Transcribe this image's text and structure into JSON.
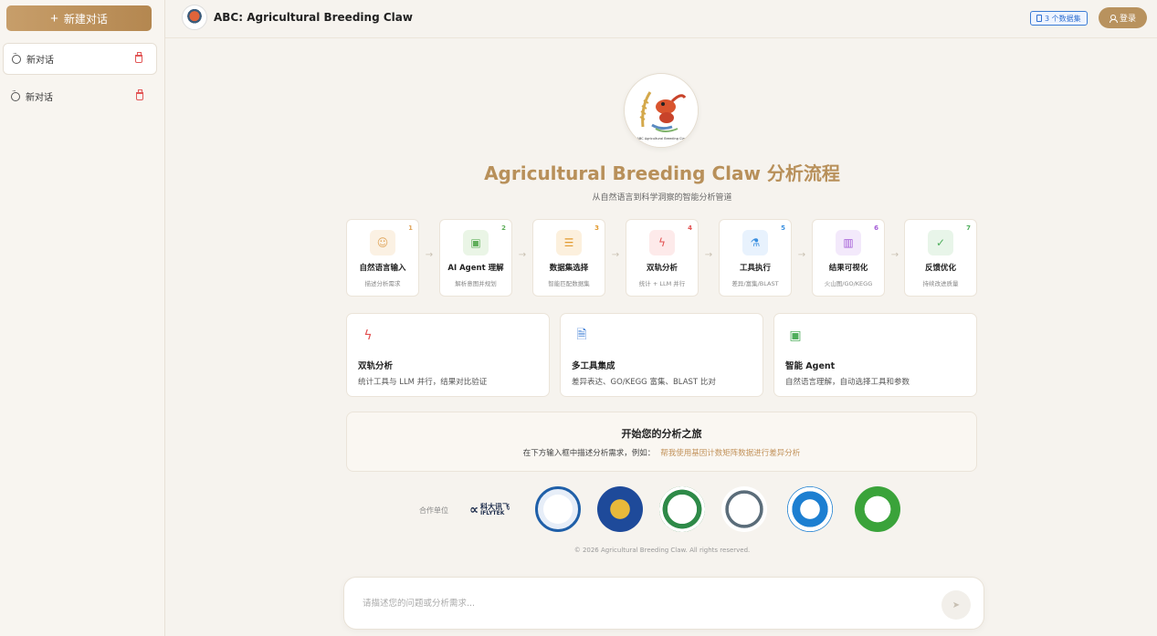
{
  "sidebar": {
    "new_chat_label": "新建对话",
    "conversations": [
      {
        "label": "新对话"
      },
      {
        "label": "新对话"
      }
    ]
  },
  "header": {
    "title": "ABC: Agricultural Breeding Claw",
    "dataset_badge": "3 个数据集",
    "login_label": "登录"
  },
  "hero": {
    "logo_text": "ABC Agricultural Breeding Claw",
    "title": "Agricultural Breeding Claw 分析流程",
    "subtitle": "从自然语言到科学洞察的智能分析管道"
  },
  "steps": [
    {
      "num": "1",
      "title": "自然语言输入",
      "desc": "描述分析需求",
      "icon": "chat-icon",
      "color": "#e0a55b",
      "bg": "#fbf1e3"
    },
    {
      "num": "2",
      "title": "AI Agent 理解",
      "desc": "解析意图并规划",
      "icon": "robot-icon",
      "color": "#5fae5a",
      "bg": "#eaf5e6"
    },
    {
      "num": "3",
      "title": "数据集选择",
      "desc": "智能匹配数据集",
      "icon": "database-icon",
      "color": "#e29a2f",
      "bg": "#fcf0dd"
    },
    {
      "num": "4",
      "title": "双轨分析",
      "desc": "统计 + LLM 并行",
      "icon": "lightning-icon",
      "color": "#e25050",
      "bg": "#fdeaea"
    },
    {
      "num": "5",
      "title": "工具执行",
      "desc": "差异/富集/BLAST",
      "icon": "flask-icon",
      "color": "#3a8fe0",
      "bg": "#e8f2fd"
    },
    {
      "num": "6",
      "title": "结果可视化",
      "desc": "火山图/GO/KEGG",
      "icon": "chart-icon",
      "color": "#a35bd6",
      "bg": "#f3e9fb"
    },
    {
      "num": "7",
      "title": "反馈优化",
      "desc": "持续改进质量",
      "icon": "check-circle-icon",
      "color": "#4fae5c",
      "bg": "#e8f5e9"
    }
  ],
  "features": [
    {
      "title": "双轨分析",
      "desc": "统计工具与 LLM 并行，结果对比验证",
      "icon": "lightning-icon",
      "color": "#e25050"
    },
    {
      "title": "多工具集成",
      "desc": "差异表达、GO/KEGG 富集、BLAST 比对",
      "icon": "file-search-icon",
      "color": "#3a7bd5"
    },
    {
      "title": "智能 Agent",
      "desc": "自然语言理解，自动选择工具和参数",
      "icon": "robot-icon",
      "color": "#4fae5c"
    }
  ],
  "start": {
    "title": "开始您的分析之旅",
    "prompt": "在下方输入框中描述分析需求，例如：",
    "example": "帮我使用基因计数矩阵数据进行差异分析"
  },
  "partners": {
    "label": "合作单位",
    "iflytek_cn": "科大讯飞",
    "iflytek_en": "IFLYTEK",
    "seals": [
      {
        "name": "partner-seal-1",
        "color": "#1f5fa8"
      },
      {
        "name": "partner-seal-2",
        "color": "#1e4a9a"
      },
      {
        "name": "partner-seal-3",
        "color": "#2e8a48"
      },
      {
        "name": "partner-seal-4",
        "color": "#5b6d7a"
      },
      {
        "name": "partner-seal-5",
        "color": "#1d7fd1"
      },
      {
        "name": "partner-seal-6",
        "color": "#3aa33a"
      }
    ]
  },
  "footer": {
    "copyright": "© 2026 Agricultural Breeding Claw. All rights reserved."
  },
  "input": {
    "placeholder": "请描述您的问题或分析需求...",
    "value": ""
  },
  "colors": {
    "accent": "#b8905a",
    "background": "#f6f3ee"
  }
}
